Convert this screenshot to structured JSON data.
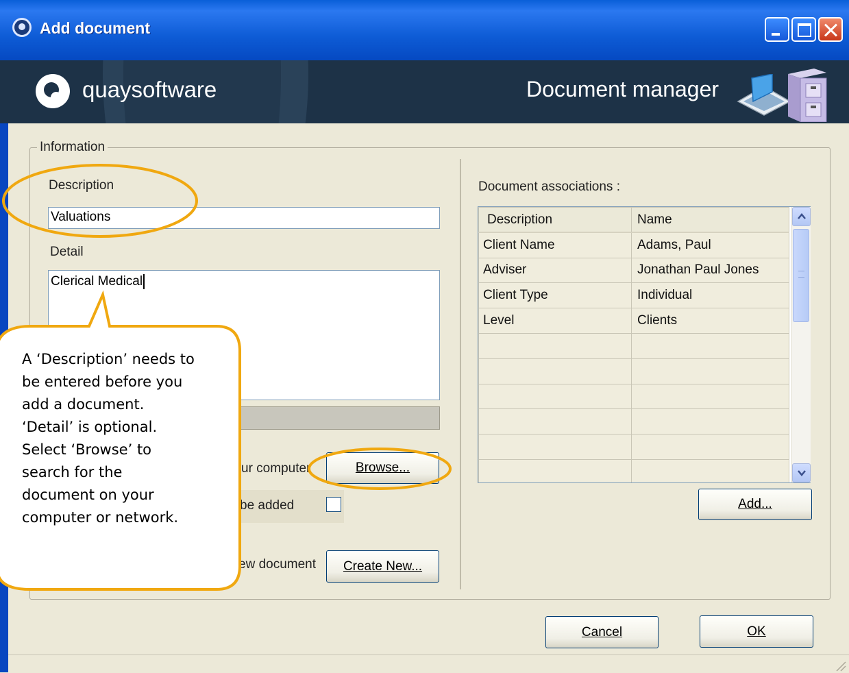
{
  "window": {
    "title": "Add document",
    "buttons": [
      "minimize",
      "maximize",
      "close"
    ]
  },
  "banner": {
    "logo_text": "quaysoftware",
    "title": "Document manager",
    "icons": [
      "scanner-icon",
      "filing-cabinet-icon"
    ]
  },
  "form": {
    "group_label": "Information",
    "description_label": "Description",
    "description_value": "Valuations",
    "detail_label": "Detail",
    "detail_value": "Clerical Medical",
    "browse_row_label": "ur computer",
    "browse_button": "Browse...",
    "confirm_row_label": "be added",
    "create_row_label": "ew document",
    "create_button": "Create New..."
  },
  "associations": {
    "label": "Document associations :",
    "columns": [
      "Description",
      "Name"
    ],
    "rows": [
      [
        "Client Name",
        "Adams, Paul"
      ],
      [
        "Adviser",
        "Jonathan Paul Jones"
      ],
      [
        "Client Type",
        "Individual"
      ],
      [
        "Level",
        "Clients"
      ]
    ],
    "add_button": "Add..."
  },
  "footer": {
    "cancel_button": "Cancel",
    "ok_button": "OK"
  },
  "callout": {
    "lines": [
      "A ‘Description’ needs to",
      "be entered before you",
      "add a document.",
      "‘Detail’ is optional.",
      "Select ‘Browse’ to",
      "search for the",
      "document on your",
      "computer or network."
    ]
  },
  "colors": {
    "annotation": "#f0a810",
    "banner_bg": "#1d3247",
    "dialog_bg": "#ece9d8"
  }
}
